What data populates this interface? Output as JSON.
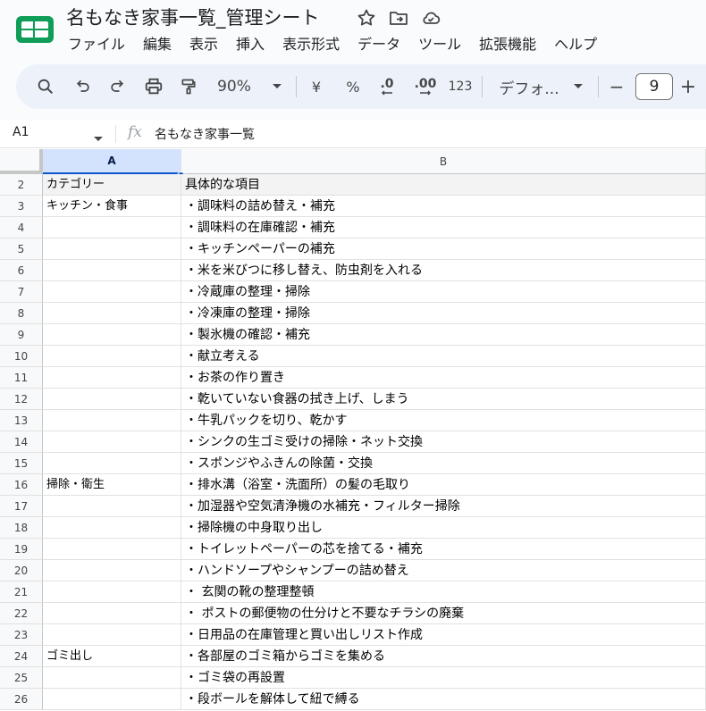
{
  "app": {
    "title": "名もなき家事一覧_管理シート",
    "title_icons": [
      "star-icon",
      "move-folder-icon",
      "cloud-status-icon"
    ]
  },
  "menu": [
    "ファイル",
    "編集",
    "表示",
    "挿入",
    "表示形式",
    "データ",
    "ツール",
    "拡張機能",
    "ヘルプ"
  ],
  "toolbar": {
    "zoom": "90%",
    "currency": "¥",
    "percent": "%",
    "decrease_decimal": ".0",
    "increase_decimal": ".00",
    "number_format": "123",
    "font": "デフォ...",
    "font_size": "9",
    "minus": "−",
    "plus": "+"
  },
  "formula_bar": {
    "cell_ref": "A1",
    "fx": "fx",
    "value": "名もなき家事一覧"
  },
  "columns": [
    "A",
    "B"
  ],
  "rows": [
    {
      "num": "2",
      "a": "カテゴリー",
      "b": "具体的な項目"
    },
    {
      "num": "3",
      "a": "キッチン・食事",
      "b": "・調味料の詰め替え・補充"
    },
    {
      "num": "4",
      "a": "",
      "b": "・調味料の在庫確認・補充"
    },
    {
      "num": "5",
      "a": "",
      "b": "・キッチンペーパーの補充"
    },
    {
      "num": "6",
      "a": "",
      "b": "・米を米びつに移し替え、防虫剤を入れる"
    },
    {
      "num": "7",
      "a": "",
      "b": "・冷蔵庫の整理・掃除"
    },
    {
      "num": "8",
      "a": "",
      "b": "・冷凍庫の整理・掃除"
    },
    {
      "num": "9",
      "a": "",
      "b": "・製氷機の確認・補充"
    },
    {
      "num": "10",
      "a": "",
      "b": "・献立考える"
    },
    {
      "num": "11",
      "a": "",
      "b": "・お茶の作り置き"
    },
    {
      "num": "12",
      "a": "",
      "b": "・乾いていない食器の拭き上げ、しまう"
    },
    {
      "num": "13",
      "a": "",
      "b": "・牛乳パックを切り、乾かす"
    },
    {
      "num": "14",
      "a": "",
      "b": "・シンクの生ゴミ受けの掃除・ネット交換"
    },
    {
      "num": "15",
      "a": "",
      "b": "・スポンジやふきんの除菌・交換"
    },
    {
      "num": "16",
      "a": "掃除・衛生",
      "b": "・排水溝（浴室・洗面所）の髪の毛取り"
    },
    {
      "num": "17",
      "a": "",
      "b": "・加湿器や空気清浄機の水補充・フィルター掃除"
    },
    {
      "num": "18",
      "a": "",
      "b": "・掃除機の中身取り出し"
    },
    {
      "num": "19",
      "a": "",
      "b": "・トイレットペーパーの芯を捨てる・補充"
    },
    {
      "num": "20",
      "a": "",
      "b": "・ハンドソープやシャンプーの詰め替え"
    },
    {
      "num": "21",
      "a": "",
      "b": "・ 玄関の靴の整理整頓"
    },
    {
      "num": "22",
      "a": "",
      "b": "・ ポストの郵便物の仕分けと不要なチラシの廃棄"
    },
    {
      "num": "23",
      "a": "",
      "b": "・日用品の在庫管理と買い出しリスト作成"
    },
    {
      "num": "24",
      "a": "ゴミ出し",
      "b": "・各部屋のゴミ箱からゴミを集める"
    },
    {
      "num": "25",
      "a": "",
      "b": "・ゴミ袋の再設置"
    },
    {
      "num": "26",
      "a": "",
      "b": "・段ボールを解体して紐で縛る"
    }
  ]
}
